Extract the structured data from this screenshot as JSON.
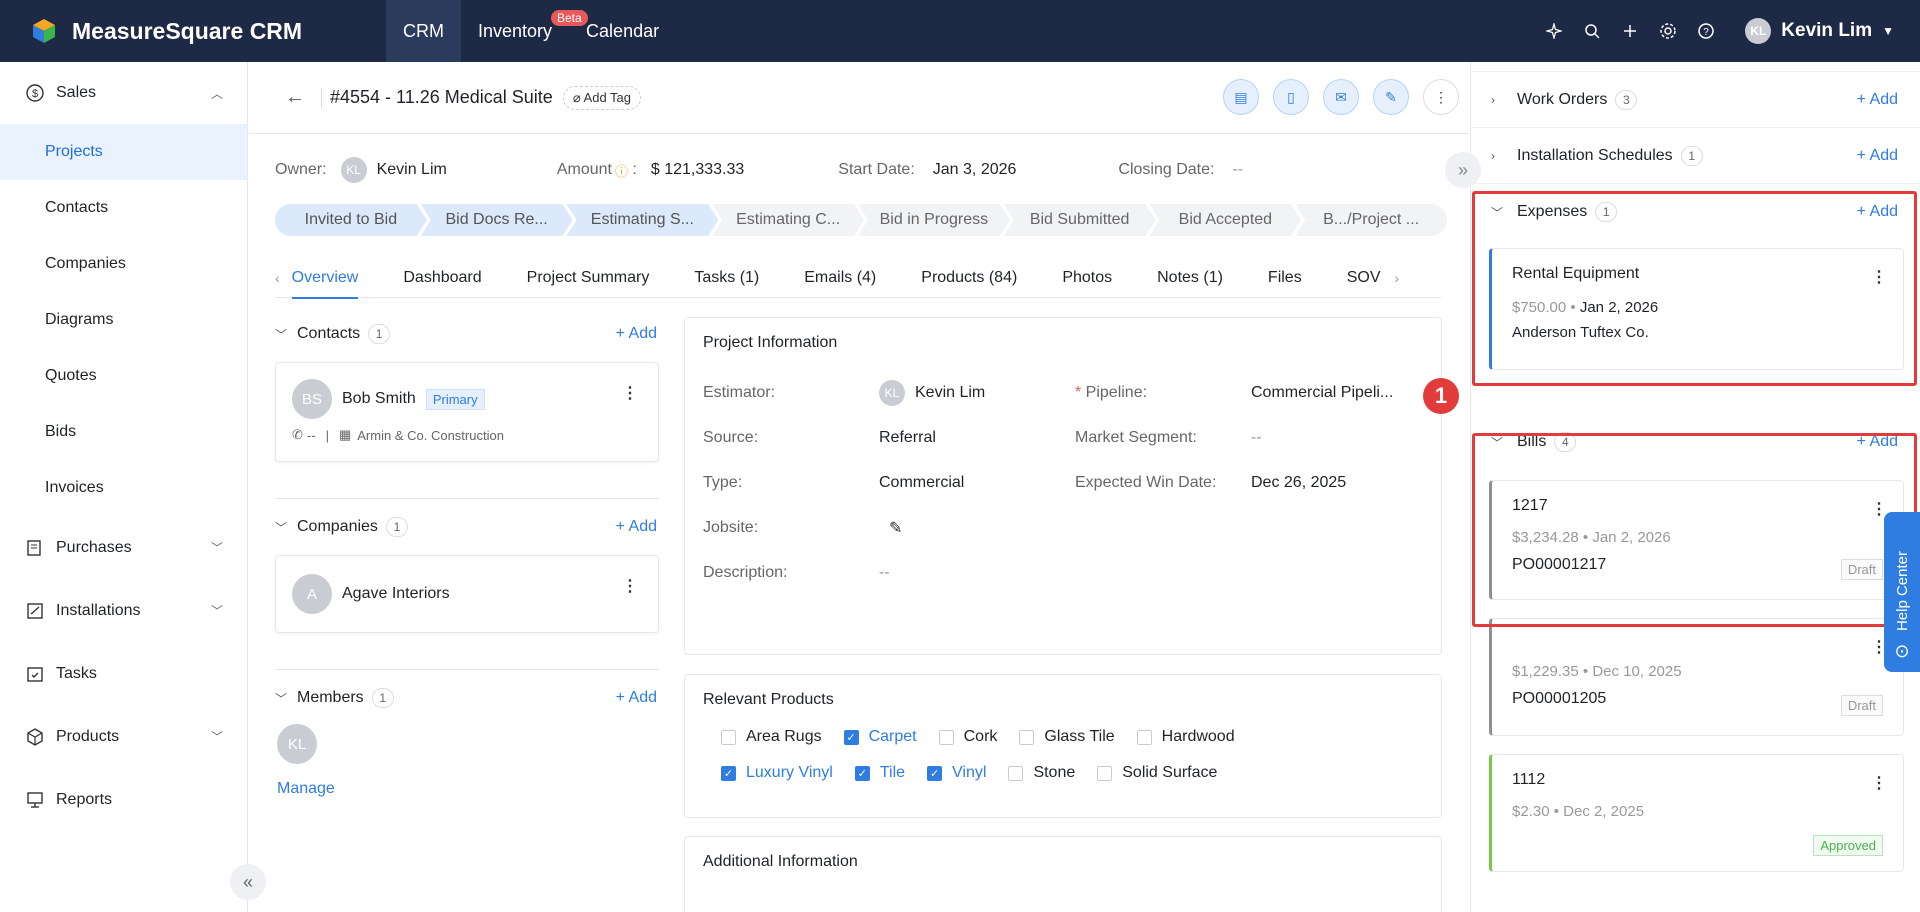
{
  "app": {
    "name": "MeasureSquare CRM"
  },
  "topnav": [
    {
      "label": "CRM"
    },
    {
      "label": "Inventory"
    },
    {
      "label": "Calendar"
    }
  ],
  "beta_badge": "Beta",
  "user": {
    "initials": "KL",
    "name": "Kevin Lim"
  },
  "sidebar": {
    "group_sales": "Sales",
    "items": [
      {
        "label": "Projects"
      },
      {
        "label": "Contacts"
      },
      {
        "label": "Companies"
      },
      {
        "label": "Diagrams"
      },
      {
        "label": "Quotes"
      },
      {
        "label": "Bids"
      },
      {
        "label": "Invoices"
      }
    ],
    "groups": [
      {
        "label": "Purchases"
      },
      {
        "label": "Installations"
      },
      {
        "label": "Tasks"
      },
      {
        "label": "Products"
      },
      {
        "label": "Reports"
      }
    ]
  },
  "project": {
    "title": "#4554 - 11.26 Medical Suite",
    "add_tag": "Add Tag",
    "owner_label": "Owner:",
    "owner_initials": "KL",
    "owner": "Kevin Lim",
    "amount_label": "Amount",
    "amount": "$ 121,333.33",
    "start_label": "Start Date:",
    "start": "Jan 3, 2026",
    "closing_label": "Closing Date:",
    "closing": "--"
  },
  "stages": [
    "Invited to Bid",
    "Bid Docs Re...",
    "Estimating S...",
    "Estimating C...",
    "Bid in Progress",
    "Bid Submitted",
    "Bid Accepted",
    "B.../Project ..."
  ],
  "tabs": [
    "Overview",
    "Dashboard",
    "Project Summary",
    "Tasks (1)",
    "Emails (4)",
    "Products (84)",
    "Photos",
    "Notes (1)",
    "Files",
    "SOV"
  ],
  "contacts": {
    "title": "Contacts",
    "count": "1",
    "add": "Add",
    "initials": "BS",
    "name": "Bob Smith",
    "primary": "Primary",
    "phone": "--",
    "sep": "|",
    "company": "Armin & Co. Construction"
  },
  "companies": {
    "title": "Companies",
    "count": "1",
    "add": "Add",
    "initial": "A",
    "name": "Agave Interiors"
  },
  "members": {
    "title": "Members",
    "count": "1",
    "add": "Add",
    "initials": "KL",
    "manage": "Manage"
  },
  "project_info": {
    "title": "Project Information",
    "estimator_label": "Estimator:",
    "estimator_initials": "KL",
    "estimator": "Kevin Lim",
    "pipeline_label": "Pipeline:",
    "pipeline": "Commercial Pipeli...",
    "source_label": "Source:",
    "source": "Referral",
    "segment_label": "Market Segment:",
    "segment": "--",
    "type_label": "Type:",
    "type": "Commercial",
    "win_label": "Expected Win Date:",
    "win": "Dec 26, 2025",
    "jobsite_label": "Jobsite:",
    "desc_label": "Description:",
    "desc": "--"
  },
  "relevant_products": {
    "title": "Relevant Products",
    "items": [
      {
        "label": "Area Rugs",
        "checked": false
      },
      {
        "label": "Carpet",
        "checked": true
      },
      {
        "label": "Cork",
        "checked": false
      },
      {
        "label": "Glass Tile",
        "checked": false
      },
      {
        "label": "Hardwood",
        "checked": false
      },
      {
        "label": "Luxury Vinyl",
        "checked": true
      },
      {
        "label": "Tile",
        "checked": true
      },
      {
        "label": "Vinyl",
        "checked": true
      },
      {
        "label": "Stone",
        "checked": false
      },
      {
        "label": "Solid Surface",
        "checked": false
      }
    ]
  },
  "additional_info": {
    "title": "Additional Information"
  },
  "panel": {
    "work_orders": {
      "title": "Work Orders",
      "count": "3",
      "add": "Add"
    },
    "install": {
      "title": "Installation Schedules",
      "count": "1",
      "add": "Add"
    },
    "expenses": {
      "title": "Expenses",
      "count": "1",
      "add": "Add",
      "card": {
        "name": "Rental Equipment",
        "amount": "$750.00",
        "dot": "•",
        "date": "Jan 2, 2026",
        "vendor": "Anderson Tuftex Co."
      }
    },
    "bills": {
      "title": "Bills",
      "count": "4",
      "add": "Add",
      "cards": [
        {
          "number": "1217",
          "amount": "$3,234.28",
          "dot": "•",
          "date": "Jan 2, 2026",
          "po": "PO00001217",
          "status": "Draft"
        },
        {
          "number": "",
          "amount": "$1,229.35",
          "dot": "•",
          "date": "Dec 10, 2025",
          "po": "PO00001205",
          "status": "Draft"
        },
        {
          "number": "1112",
          "amount": "$2.30",
          "dot": "•",
          "date": "Dec 2, 2025",
          "po": "",
          "status": "Approved"
        }
      ]
    }
  },
  "annotation_badge": "1",
  "help_center": "Help Center",
  "colors": {
    "accent": "#2f7de1",
    "topbar": "#1e2a45",
    "highlight": "#e23b3b"
  }
}
